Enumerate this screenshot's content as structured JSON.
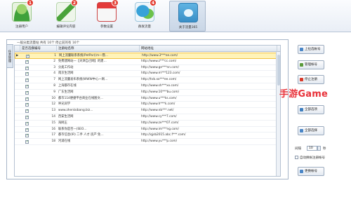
{
  "toolbar": {
    "items": [
      {
        "label": "注册用户",
        "badge": "1",
        "icon": "user-icon"
      },
      {
        "label": "编辑评论内容",
        "badge": "2",
        "icon": "pen-icon"
      },
      {
        "label": "参数设置",
        "badge": "3",
        "icon": "calendar-icon"
      },
      {
        "label": "群发流量",
        "badge": "4",
        "icon": "chat-icon"
      },
      {
        "label": "关于流量365",
        "badge": "",
        "icon": "image-icon"
      }
    ]
  },
  "side_tab": {
    "label": "任务管理"
  },
  "summary": "一般分类流量站 共有 16个 停止前的有 16个",
  "grid": {
    "columns": [
      "是否选择",
      "编号",
      "注册站名称",
      "网站地址"
    ],
    "rows": [
      {
        "checked": true,
        "num": "1",
        "name": "网上流量联系系统(PetPar)(m一鼎…",
        "url": "http://www.3***ee.com/",
        "selected": true
      },
      {
        "checked": true,
        "num": "2",
        "name": "免费建网站—【天津自己网】的建…",
        "url": "http://www.z***cc.com/",
        "selected": false
      },
      {
        "checked": true,
        "num": "3",
        "name": "分类工作站",
        "url": "http://www.ge***nn.com/",
        "selected": false
      },
      {
        "checked": true,
        "num": "4",
        "name": "南京生活网",
        "url": "http://www.m***123.com/",
        "selected": false
      },
      {
        "checked": true,
        "num": "7",
        "name": "网上流量发布系统(WWW中心一网…",
        "url": "http://tvb.xo***ee.com/",
        "selected": false
      },
      {
        "checked": true,
        "num": "8",
        "name": "上海都市在线",
        "url": "http://www.sh***xx.com/",
        "selected": false
      },
      {
        "checked": true,
        "num": "9",
        "name": "广东生活网",
        "url": "http://www.10***bu.com/",
        "selected": false
      },
      {
        "checked": true,
        "num": "10",
        "name": "都市114便捷平台商业在线图文…",
        "url": "http://www.u***ks.com/",
        "selected": false
      },
      {
        "checked": true,
        "num": "12",
        "name": "呼兄同学",
        "url": "http://www.h***k.com/",
        "selected": false
      },
      {
        "checked": true,
        "num": "13",
        "name": "www.zhenlaibang.biz…",
        "url": "http://www.nb***.net/",
        "selected": false
      },
      {
        "checked": true,
        "num": "14",
        "name": "西安生活网",
        "url": "http://www.cy***7.com/",
        "selected": false
      },
      {
        "checked": true,
        "num": "15",
        "name": "海网王",
        "url": "http://www.ze***07.com/",
        "selected": false
      },
      {
        "checked": true,
        "num": "16",
        "name": "联系你是否—(SEO…",
        "url": "http://www.im***ng.com/",
        "selected": false
      },
      {
        "checked": true,
        "num": "17",
        "name": "都市信息(IR) 二手 人才 房产 免…",
        "url": "http://qjsb2015.abc.f***.com/",
        "selected": false
      },
      {
        "checked": true,
        "num": "18",
        "name": "河浦在线",
        "url": "http://www.yu***p.com/",
        "selected": false
      }
    ]
  },
  "actions": {
    "b1": "上拉选帐号",
    "b2": "管理帐号",
    "b3": "停止注册",
    "b4": "全部选项",
    "b5": "全部选择",
    "b6": "更换帐号"
  },
  "options": {
    "interval_label": "间隔",
    "interval_value": "10",
    "interval_unit": "秒",
    "auto_label": "自动换帐注册帐号"
  },
  "watermark": "手游Game",
  "colors": {
    "badge": "#e23a2e",
    "selected_row": "#fff3b8",
    "watermark": "#e8323a"
  }
}
